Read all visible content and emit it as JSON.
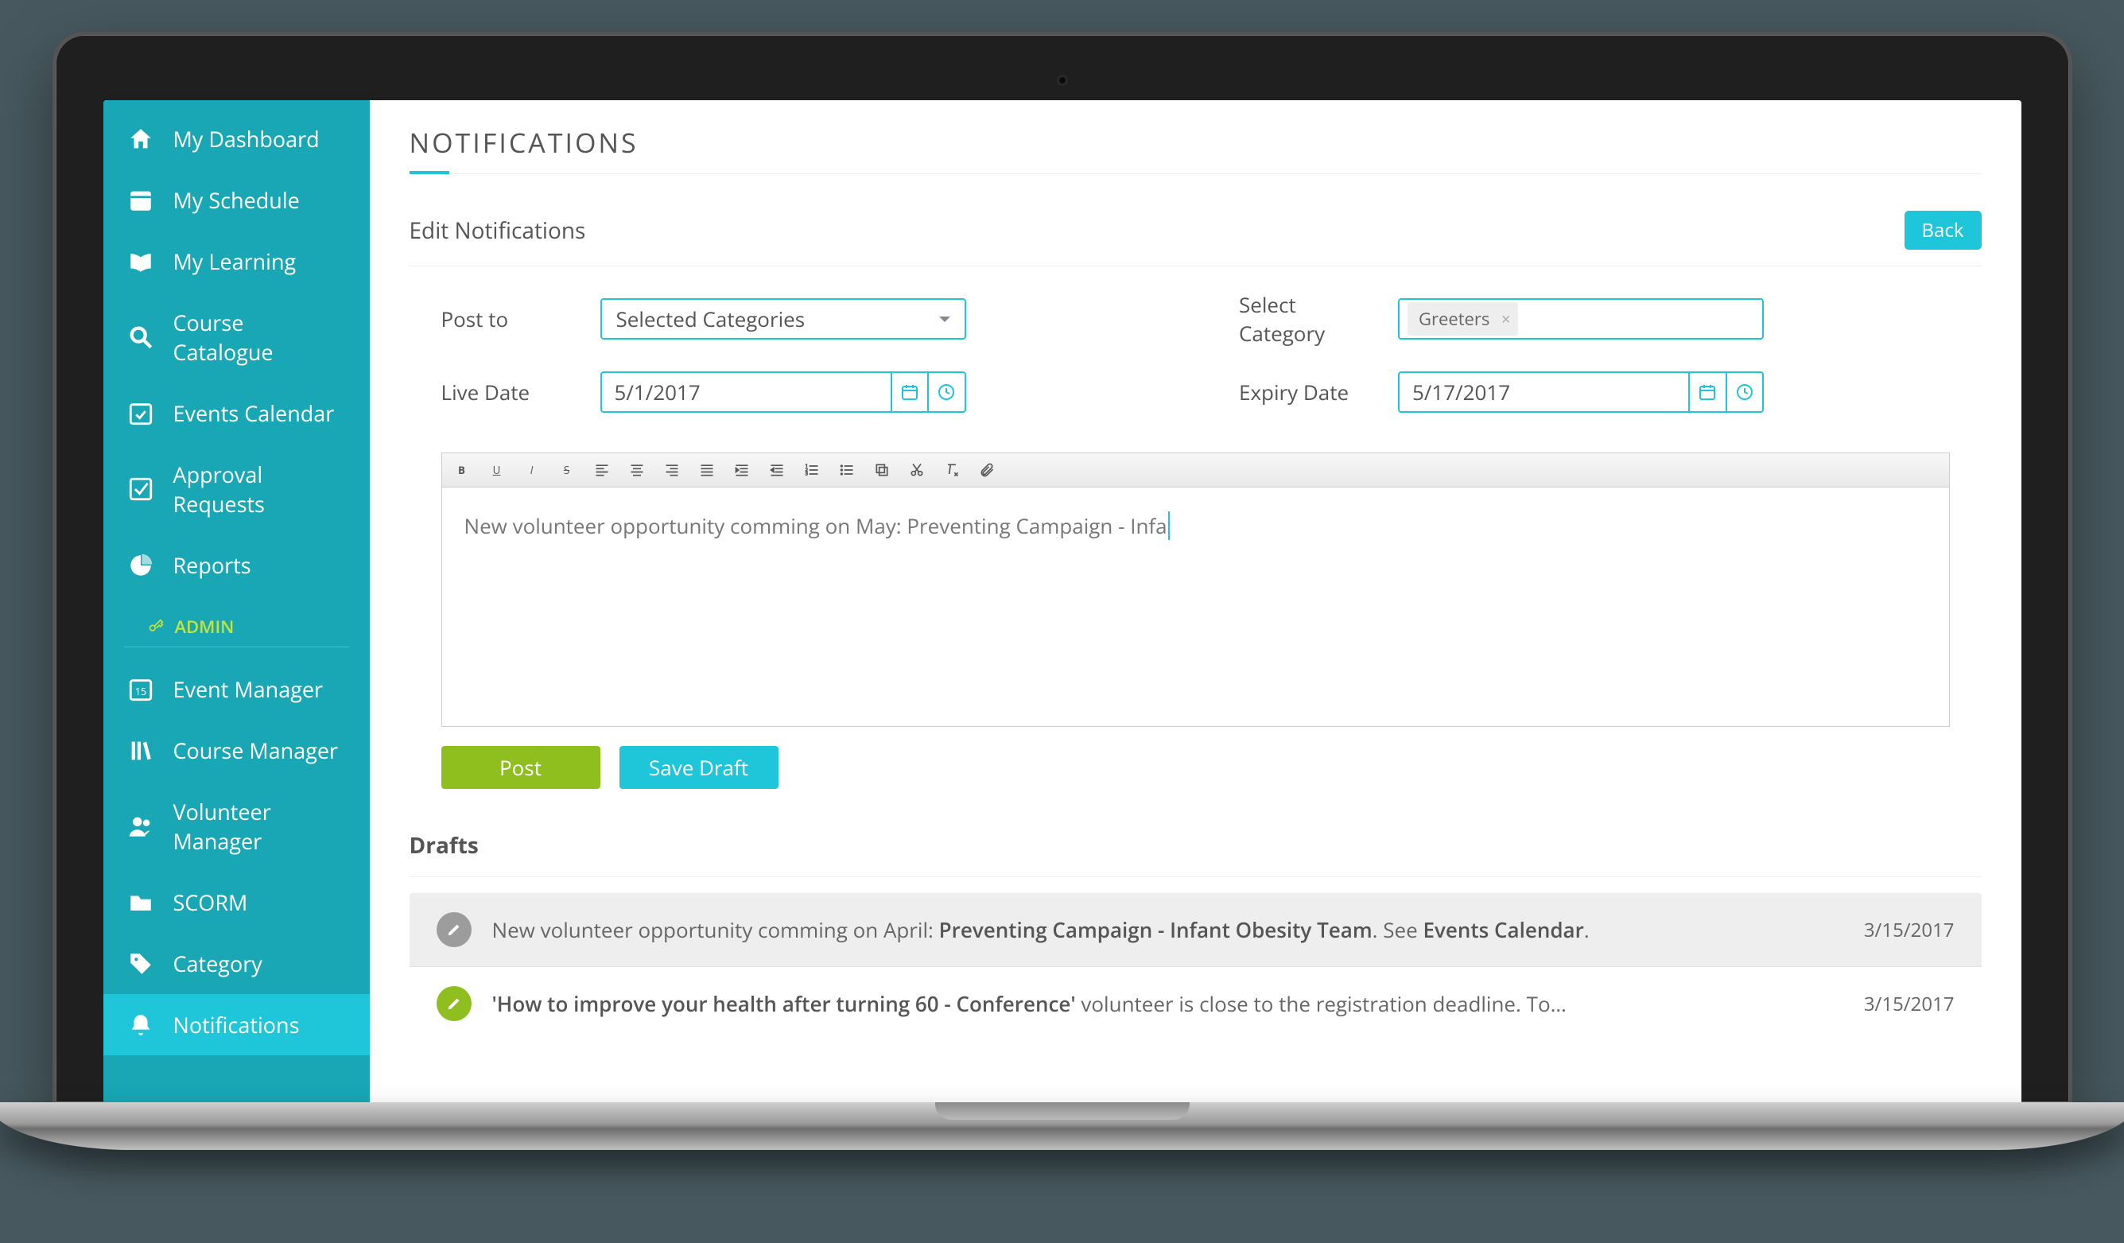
{
  "sidebar": {
    "items": [
      {
        "label": "My Dashboard",
        "active": false
      },
      {
        "label": "My Schedule",
        "active": false
      },
      {
        "label": "My Learning",
        "active": false
      },
      {
        "label": "Course Catalogue",
        "active": false
      },
      {
        "label": "Events Calendar",
        "active": false
      },
      {
        "label": "Approval Requests",
        "active": false
      },
      {
        "label": "Reports",
        "active": false
      }
    ],
    "admin_label": "ADMIN",
    "admin_items": [
      {
        "label": "Event Manager",
        "active": false
      },
      {
        "label": "Course Manager",
        "active": false
      },
      {
        "label": "Volunteer Manager",
        "active": false
      },
      {
        "label": "SCORM",
        "active": false
      },
      {
        "label": "Category",
        "active": false
      },
      {
        "label": "Notifications",
        "active": true
      }
    ]
  },
  "page": {
    "title": "NOTIFICATIONS",
    "panel_title": "Edit Notifications",
    "back": "Back"
  },
  "form": {
    "post_to": {
      "label": "Post to",
      "value": "Selected Categories"
    },
    "select_category": {
      "label": "Select Category",
      "tags": [
        "Greeters"
      ]
    },
    "live_date": {
      "label": "Live Date",
      "value": "5/1/2017"
    },
    "expiry_date": {
      "label": "Expiry Date",
      "value": "5/17/2017"
    },
    "editor_text": "New volunteer opportunity comming on May: Preventing Campaign - Infa",
    "post_btn": "Post",
    "draft_btn": "Save Draft"
  },
  "drafts": {
    "title": "Drafts",
    "items": [
      {
        "color": "gray",
        "pre": "New volunteer opportunity comming on April: ",
        "bold": "Preventing Campaign - Infant Obesity Team",
        "mid": ". See ",
        "bold2": "Events Calendar",
        "post": ".",
        "date": "3/15/2017"
      },
      {
        "color": "green",
        "pre": "",
        "bold": "'How to improve your health after turning 60 - Conference'",
        "mid": " volunteer is close to the registration deadline. To…",
        "bold2": "",
        "post": "",
        "date": "3/15/2017"
      }
    ]
  }
}
